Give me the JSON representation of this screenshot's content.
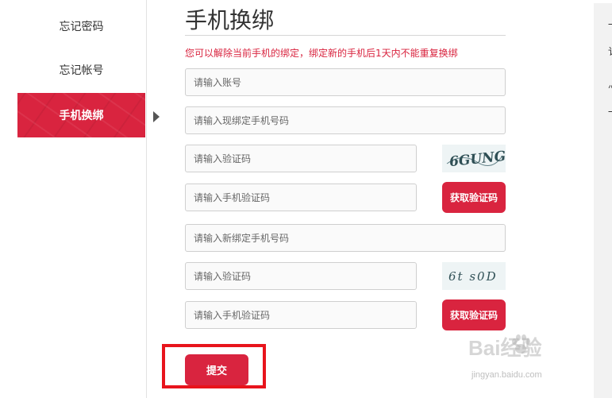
{
  "sidebar": {
    "items": [
      {
        "label": "忘记密码",
        "active": false
      },
      {
        "label": "忘记帐号",
        "active": false
      },
      {
        "label": "手机换绑",
        "active": true
      }
    ]
  },
  "page": {
    "title": "手机换绑",
    "notice": "您可以解除当前手机的绑定，绑定新的手机后1天内不能重复换绑"
  },
  "form": {
    "account_placeholder": "请输入账号",
    "current_phone_placeholder": "请输入现绑定手机号码",
    "captcha1_placeholder": "请输入验证码",
    "captcha1_image_text": "6GUNG",
    "sms_code1_placeholder": "请输入手机验证码",
    "get_code1_label": "获取验证码",
    "new_phone_placeholder": "请输入新绑定手机号码",
    "captcha2_placeholder": "请输入验证码",
    "captcha2_image_text": "6t  s0D",
    "sms_code2_placeholder": "请输入手机验证码",
    "get_code2_label": "获取验证码",
    "submit_label": "提交"
  },
  "right_panel": {
    "fragments": [
      "一",
      "讠",
      "灬",
      "一"
    ]
  },
  "watermark": {
    "text": "Bai经验",
    "sub": "jingyan.baidu.com"
  },
  "colors": {
    "accent": "#d9243f",
    "highlight_box": "#e8141c",
    "notice_text": "#d9243f"
  }
}
